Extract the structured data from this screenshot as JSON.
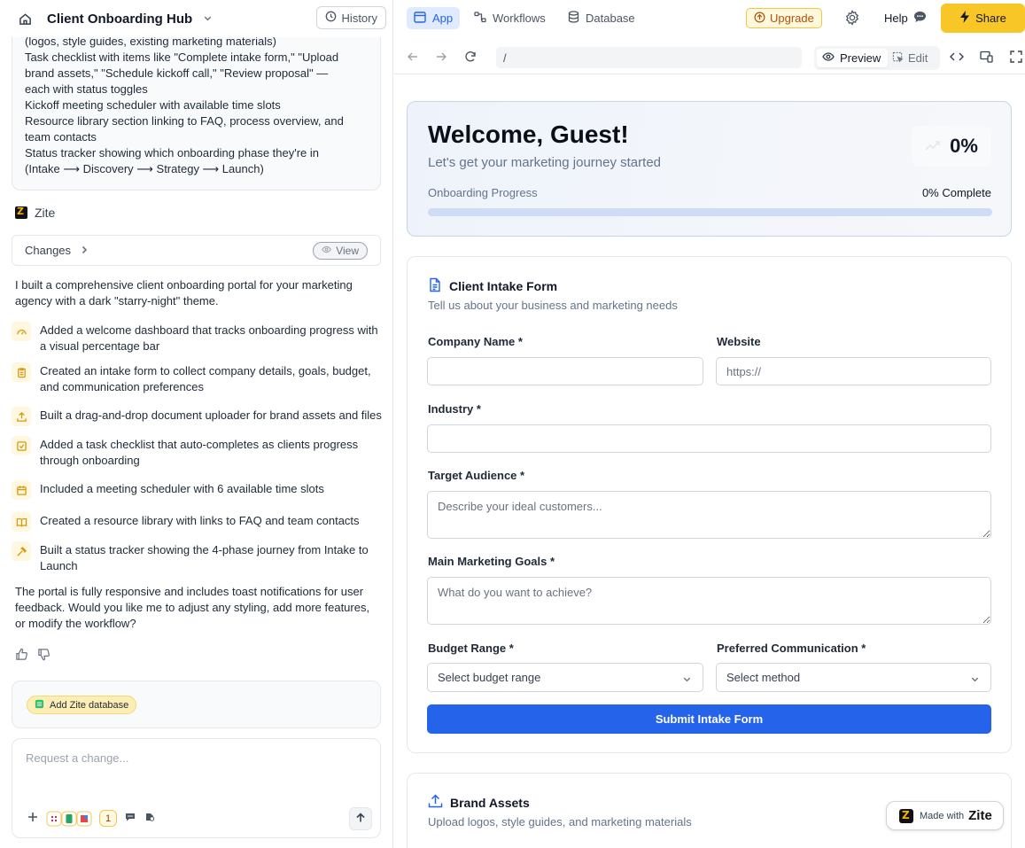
{
  "project": {
    "title": "Client Onboarding Hub",
    "history_label": "History"
  },
  "spec_lines": [
    "(logos, style guides, existing marketing materials)",
    "Task checklist with items like \"Complete intake form,\" \"Upload",
    "brand assets,\" \"Schedule kickoff call,\" \"Review proposal\" —",
    "each with status toggles",
    "Kickoff meeting scheduler with available time slots",
    "Resource library section linking to FAQ, process overview, and",
    "team contacts",
    "Status tracker showing which onboarding phase they're in",
    "(Intake ⟶ Discovery ⟶ Strategy ⟶ Launch)"
  ],
  "assistant": {
    "name": "Zite",
    "changes_label": "Changes",
    "view_label": "View",
    "intro": "I built a comprehensive client onboarding portal for your marketing agency with a dark \"starry-night\" theme.",
    "features": [
      {
        "icon": "gauge-icon",
        "text": "Added a welcome dashboard that tracks onboarding progress with a visual percentage bar"
      },
      {
        "icon": "clipboard-icon",
        "text": "Created an intake form to collect company details, goals, budget, and communication preferences"
      },
      {
        "icon": "upload-icon",
        "text": "Built a drag-and-drop document uploader for brand assets and files"
      },
      {
        "icon": "checkbox-icon",
        "text": "Added a task checklist that auto-completes as clients progress through onboarding"
      },
      {
        "icon": "calendar-icon",
        "text": "Included a meeting scheduler with 6 available time slots"
      },
      {
        "icon": "book-icon",
        "text": "Created a resource library with links to FAQ and team contacts"
      },
      {
        "icon": "hammer-icon",
        "text": "Built a status tracker showing the 4-phase journey from Intake to Launch"
      }
    ],
    "outro": "The portal is fully responsive and includes toast notifications for user feedback. Would you like me to adjust any styling, add more features, or modify the workflow?"
  },
  "db_pill_label": "Add Zite database",
  "chat": {
    "placeholder": "Request a change...",
    "badge_count": "1"
  },
  "nav": {
    "tabs": [
      {
        "label": "App"
      },
      {
        "label": "Workflows"
      },
      {
        "label": "Database"
      }
    ],
    "upgrade_label": "Upgrade",
    "help_label": "Help",
    "share_label": "Share"
  },
  "toolbar": {
    "url": "/",
    "preview_label": "Preview",
    "edit_label": "Edit"
  },
  "welcome": {
    "title": "Welcome, Guest!",
    "subtitle": "Let's get your marketing journey started",
    "percent_label": "0%",
    "progress_label": "Onboarding Progress",
    "progress_complete": "0% Complete",
    "progress_fraction": 0
  },
  "intake_form": {
    "title": "Client Intake Form",
    "subtitle": "Tell us about your business and marketing needs",
    "company_label": "Company Name *",
    "company_value": "",
    "website_label": "Website",
    "website_placeholder": "https://",
    "industry_label": "Industry *",
    "industry_value": "",
    "audience_label": "Target Audience *",
    "audience_placeholder": "Describe your ideal customers...",
    "goals_label": "Main Marketing Goals *",
    "goals_placeholder": "What do you want to achieve?",
    "budget_label": "Budget Range *",
    "budget_selected": "Select budget range",
    "comm_label": "Preferred Communication *",
    "comm_selected": "Select method",
    "submit_label": "Submit Intake Form"
  },
  "brand_assets": {
    "title": "Brand Assets",
    "subtitle": "Upload logos, style guides, and marketing materials"
  },
  "made_with": {
    "prefix": "Made with",
    "brand": "Zite"
  },
  "colors": {
    "accent": "#2563eb",
    "share": "#f8c727",
    "upgrade": "#b45309"
  }
}
